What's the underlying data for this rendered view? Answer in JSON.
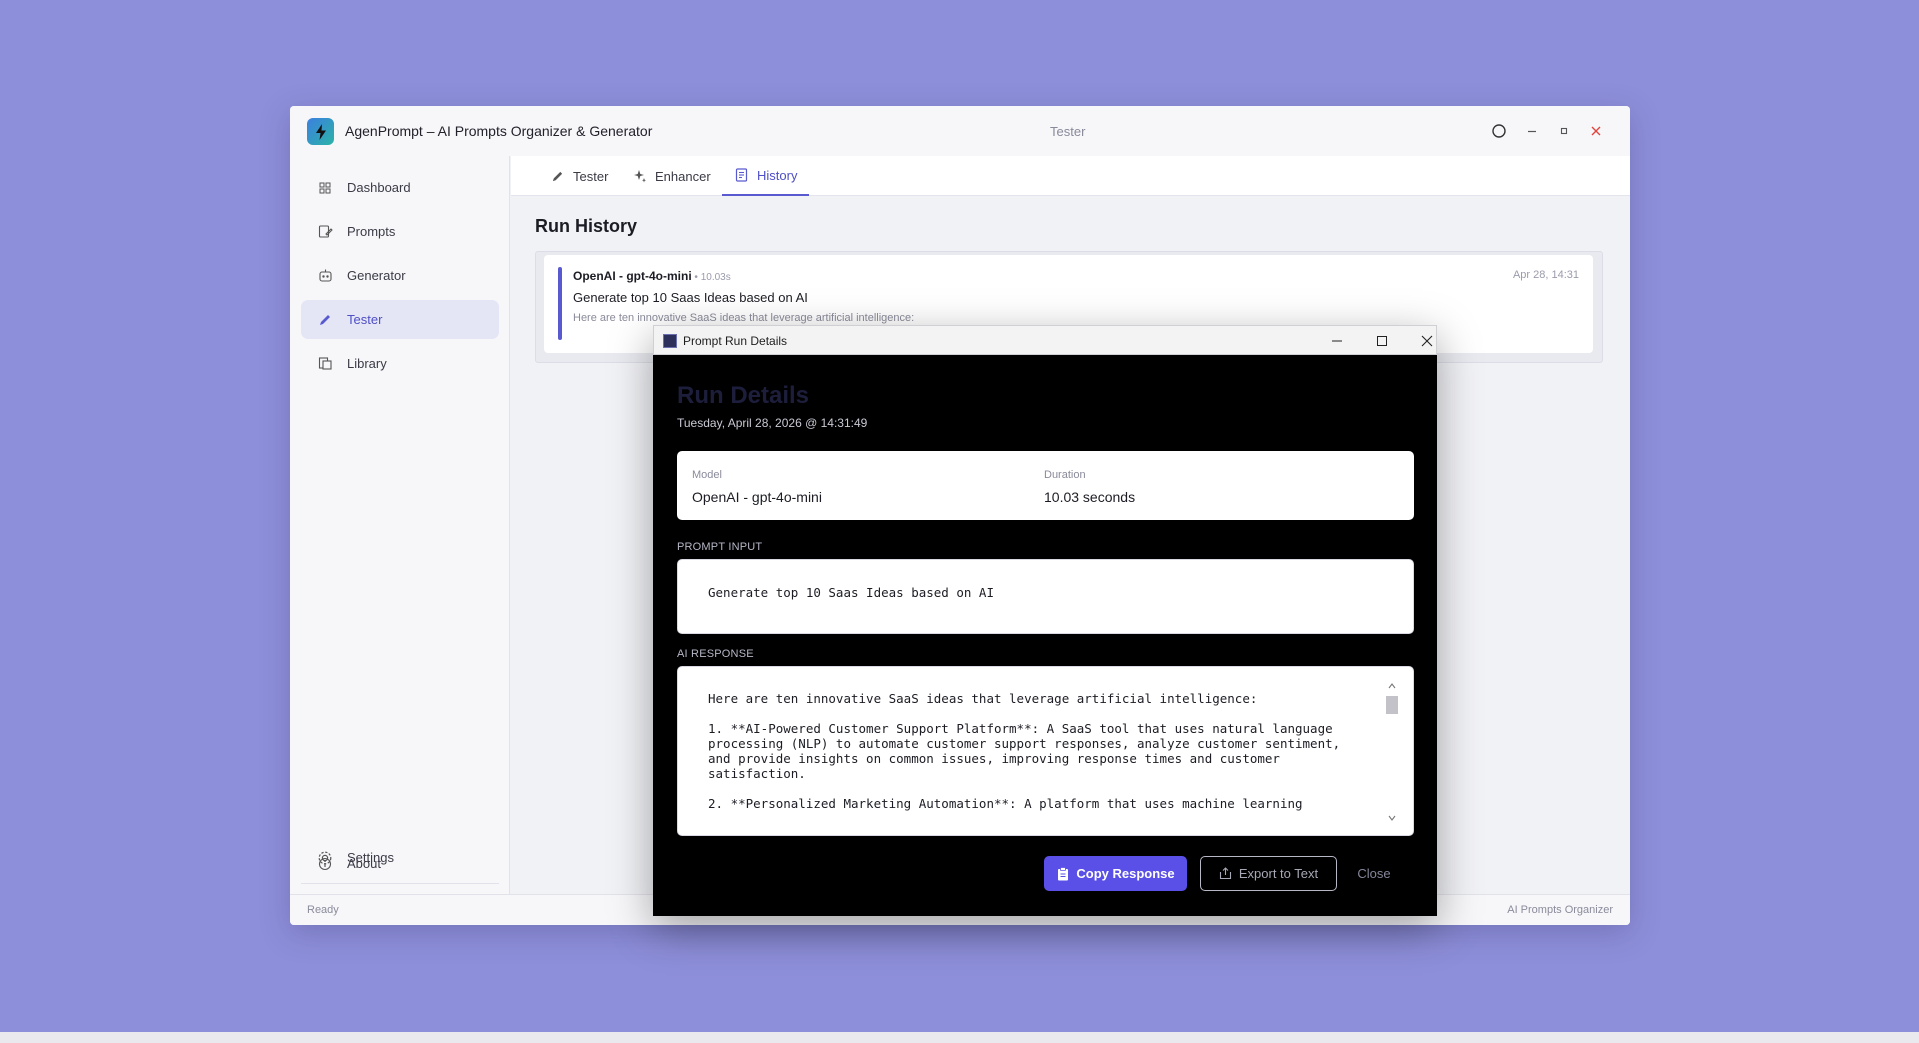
{
  "app": {
    "title": "AgenPrompt – AI Prompts Organizer & Generator",
    "center_title": "Tester",
    "status_left": "Ready",
    "status_right": "AI Prompts Organizer"
  },
  "sidebar": {
    "items": [
      {
        "label": "Dashboard",
        "icon": "grid-icon"
      },
      {
        "label": "Prompts",
        "icon": "edit-document-icon"
      },
      {
        "label": "Generator",
        "icon": "robot-icon"
      },
      {
        "label": "Tester",
        "icon": "pencil-icon",
        "active": true
      },
      {
        "label": "Library",
        "icon": "library-icon"
      }
    ],
    "bottom_items": [
      {
        "label": "About",
        "icon": "info-icon"
      },
      {
        "label": "Settings",
        "icon": "gear-icon"
      }
    ]
  },
  "tabs": [
    {
      "label": "Tester",
      "icon": "pencil-icon"
    },
    {
      "label": "Enhancer",
      "icon": "sparkle-icon"
    },
    {
      "label": "History",
      "icon": "history-icon",
      "active": true
    }
  ],
  "history": {
    "heading": "Run History",
    "entries": [
      {
        "provider": "OpenAI - gpt-4o-mini",
        "duration": " • 10.03s",
        "date": "Apr 28, 14:31",
        "title": "Generate top 10 Saas Ideas based on AI",
        "snippet": "Here are ten innovative SaaS ideas that leverage artificial intelligence:"
      }
    ]
  },
  "dialog": {
    "window_title": "Prompt Run Details",
    "heading": "Run Details",
    "datetime": "Tuesday, April 28, 2026 @ 14:31:49",
    "model_label": "Model",
    "model_value": "OpenAI - gpt-4o-mini",
    "duration_label": "Duration",
    "duration_value": "10.03 seconds",
    "prompt_label": "PROMPT INPUT",
    "prompt_text": "Generate top 10 Saas Ideas based on AI",
    "response_label": "AI RESPONSE",
    "response_text": "Here are ten innovative SaaS ideas that leverage artificial intelligence:\n\n1. **AI-Powered Customer Support Platform**: A SaaS tool that uses natural language\nprocessing (NLP) to automate customer support responses, analyze customer sentiment,\nand provide insights on common issues, improving response times and customer\nsatisfaction.\n\n2. **Personalized Marketing Automation**: A platform that uses machine learning",
    "copy_label": "Copy Response",
    "export_label": "Export to Text",
    "close_label": "Close"
  },
  "colors": {
    "desktop": "#8e8fda",
    "accent": "#5a5ad0",
    "primary_button": "#5a4fe6",
    "close_red": "#e0443e"
  }
}
